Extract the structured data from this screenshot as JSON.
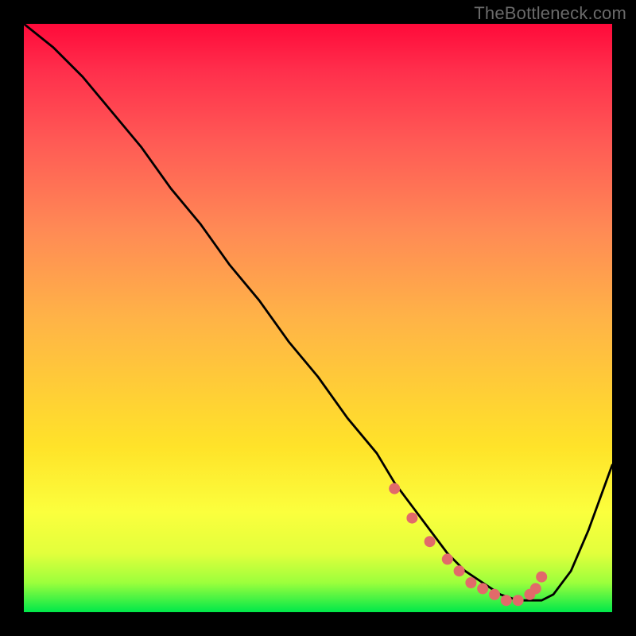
{
  "watermark": "TheBottleneck.com",
  "chart_data": {
    "type": "line",
    "title": "",
    "xlabel": "",
    "ylabel": "",
    "xlim": [
      0,
      100
    ],
    "ylim": [
      0,
      100
    ],
    "grid": false,
    "series": [
      {
        "name": "bottleneck-curve",
        "color": "#000000",
        "x": [
          0,
          5,
          10,
          15,
          20,
          25,
          30,
          35,
          40,
          45,
          50,
          55,
          60,
          63,
          66,
          69,
          72,
          75,
          78,
          81,
          84,
          87,
          88,
          90,
          93,
          96,
          100
        ],
        "y": [
          100,
          96,
          91,
          85,
          79,
          72,
          66,
          59,
          53,
          46,
          40,
          33,
          27,
          22,
          18,
          14,
          10,
          7,
          5,
          3,
          2,
          2,
          2,
          3,
          7,
          14,
          25
        ]
      }
    ],
    "markers": {
      "name": "optimal-range-dots",
      "color": "#e26a6a",
      "x": [
        63,
        66,
        69,
        72,
        74,
        76,
        78,
        80,
        82,
        84,
        86,
        87,
        88
      ],
      "y": [
        21,
        16,
        12,
        9,
        7,
        5,
        4,
        3,
        2,
        2,
        3,
        4,
        6
      ]
    }
  }
}
